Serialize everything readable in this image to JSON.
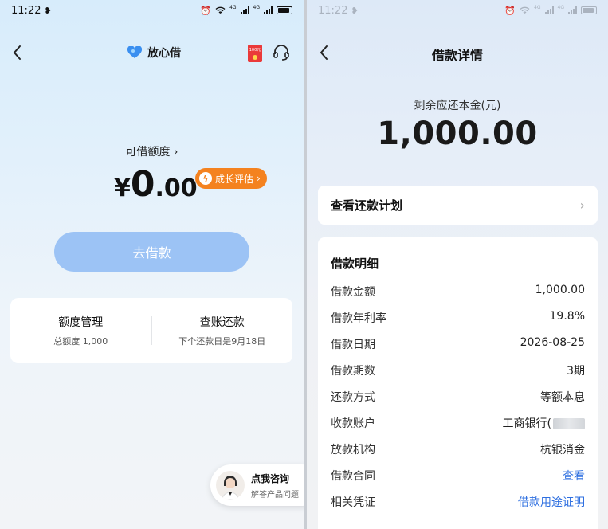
{
  "left": {
    "status": {
      "time": "11:22",
      "signal1": "4G",
      "signal2": "4G"
    },
    "brand": "放心借",
    "redpack_text": "100元",
    "available_label": "可借额度",
    "amount": {
      "currency": "¥",
      "integer": "0",
      "decimal": ".00"
    },
    "growth_badge": "成长评估",
    "borrow_button": "去借款",
    "quick": [
      {
        "title": "额度管理",
        "sub": "总额度 1,000"
      },
      {
        "title": "查账还款",
        "sub": "下个还款日是9月18日"
      }
    ],
    "consult": {
      "title": "点我咨询",
      "sub": "解答产品问题"
    }
  },
  "right": {
    "status": {
      "time": "11:22",
      "signal1": "4G",
      "signal2": "4G"
    },
    "title": "借款详情",
    "remain_label": "剩余应还本金(元)",
    "remain_amount": "1,000.00",
    "plan_label": "查看还款计划",
    "detail_title": "借款明细",
    "details": [
      {
        "key": "借款金额",
        "value": "1,000.00"
      },
      {
        "key": "借款年利率",
        "value": "19.8%"
      },
      {
        "key": "借款日期",
        "value": "2026-08-25"
      },
      {
        "key": "借款期数",
        "value": "3期"
      },
      {
        "key": "还款方式",
        "value": "等额本息"
      },
      {
        "key": "收款账户",
        "value": "工商银行("
      },
      {
        "key": "放款机构",
        "value": "杭银消金"
      },
      {
        "key": "借款合同",
        "value": "查看"
      },
      {
        "key": "相关凭证",
        "value": "借款用途证明"
      }
    ]
  },
  "colors": {
    "primary_button": "#9cc3f5",
    "badge": "#f4821f",
    "link": "#2e6fe0"
  }
}
